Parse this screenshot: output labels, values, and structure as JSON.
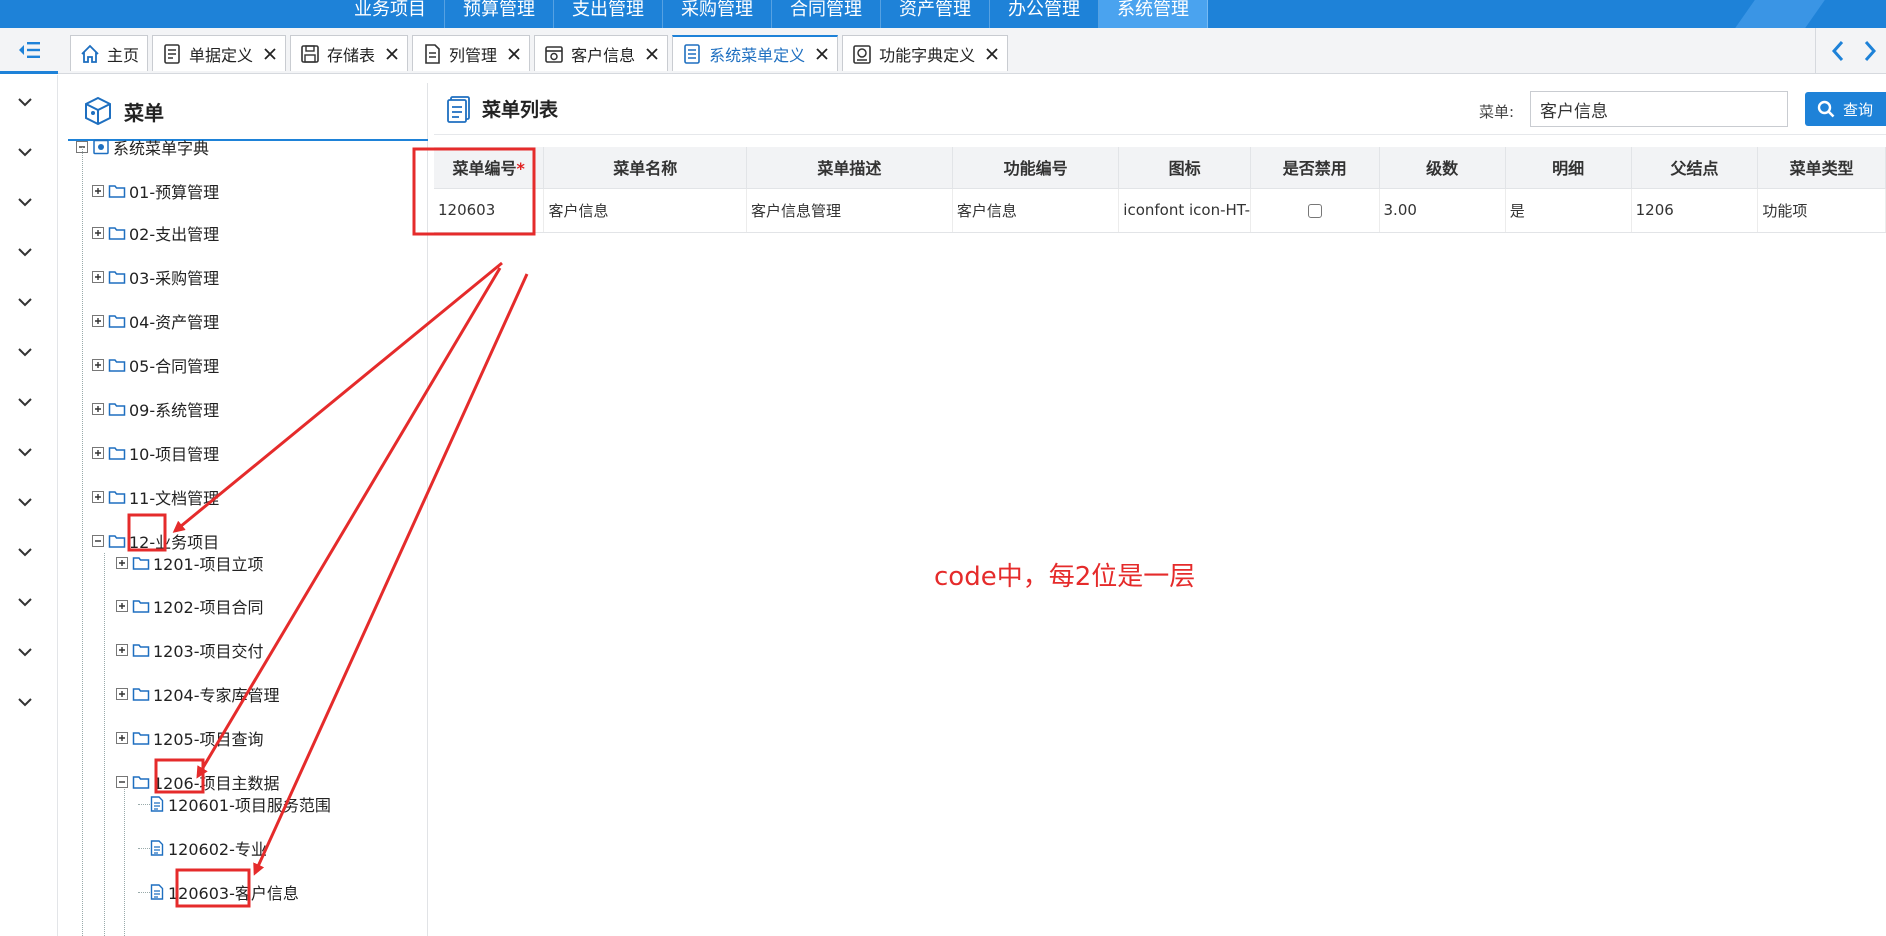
{
  "topnav": {
    "items": [
      {
        "label": "业务项目",
        "active": false
      },
      {
        "label": "预算管理",
        "active": false
      },
      {
        "label": "支出管理",
        "active": false
      },
      {
        "label": "采购管理",
        "active": false
      },
      {
        "label": "合同管理",
        "active": false
      },
      {
        "label": "资产管理",
        "active": false
      },
      {
        "label": "办公管理",
        "active": false
      },
      {
        "label": "系统管理",
        "active": true
      }
    ]
  },
  "tabs": [
    {
      "label": "主页",
      "icon": "home-icon",
      "closable": false,
      "active": false
    },
    {
      "label": "单据定义",
      "icon": "form-icon",
      "closable": true,
      "active": false
    },
    {
      "label": "存储表",
      "icon": "save-icon",
      "closable": true,
      "active": false
    },
    {
      "label": "列管理",
      "icon": "list-icon",
      "closable": true,
      "active": false
    },
    {
      "label": "客户信息",
      "icon": "customer-icon",
      "closable": true,
      "active": false
    },
    {
      "label": "系统菜单定义",
      "icon": "menu-doc-icon",
      "closable": true,
      "active": true
    },
    {
      "label": "功能字典定义",
      "icon": "dictionary-icon",
      "closable": true,
      "active": false
    }
  ],
  "tree": {
    "title": "菜单",
    "root": "系统菜单字典",
    "nodes": [
      {
        "label": "01-预算管理",
        "level": 1,
        "expanded": false
      },
      {
        "label": "02-支出管理",
        "level": 1,
        "expanded": false
      },
      {
        "label": "03-采购管理",
        "level": 1,
        "expanded": false
      },
      {
        "label": "04-资产管理",
        "level": 1,
        "expanded": false
      },
      {
        "label": "05-合同管理",
        "level": 1,
        "expanded": false
      },
      {
        "label": "09-系统管理",
        "level": 1,
        "expanded": false
      },
      {
        "label": "10-项目管理",
        "level": 1,
        "expanded": false
      },
      {
        "label": "11-文档管理",
        "level": 1,
        "expanded": false
      },
      {
        "label": "12-业务项目",
        "level": 1,
        "expanded": true
      },
      {
        "label": "1201-项目立项",
        "level": 2,
        "expanded": false
      },
      {
        "label": "1202-项目合同",
        "level": 2,
        "expanded": false
      },
      {
        "label": "1203-项目交付",
        "level": 2,
        "expanded": false
      },
      {
        "label": "1204-专家库管理",
        "level": 2,
        "expanded": false
      },
      {
        "label": "1205-项目查询",
        "level": 2,
        "expanded": false
      },
      {
        "label": "1206-项目主数据",
        "level": 2,
        "expanded": true
      },
      {
        "label": "120601-项目服务范围",
        "level": 3,
        "leaf": true
      },
      {
        "label": "120602-专业",
        "level": 3,
        "leaf": true
      },
      {
        "label": "120603-客户信息",
        "level": 3,
        "leaf": true
      }
    ]
  },
  "main": {
    "title": "菜单列表",
    "search": {
      "label": "菜单:",
      "value": "客户信息",
      "button": "查询"
    },
    "columns": [
      "菜单编号",
      "菜单名称",
      "菜单描述",
      "功能编号",
      "图标",
      "是否禁用",
      "级数",
      "明细",
      "父结点",
      "菜单类型"
    ],
    "required_marker": "*",
    "rows": [
      [
        "120603",
        "客户信息",
        "客户信息管理",
        "客户信息",
        "iconfont icon-HT-",
        "",
        "3.00",
        "是",
        "1206",
        "功能项"
      ]
    ]
  },
  "annotation": {
    "text": "code中，每2位是一层",
    "color": "#e52b2b"
  },
  "colors": {
    "primary": "#1e82d8",
    "annotation": "#e52b2b"
  }
}
